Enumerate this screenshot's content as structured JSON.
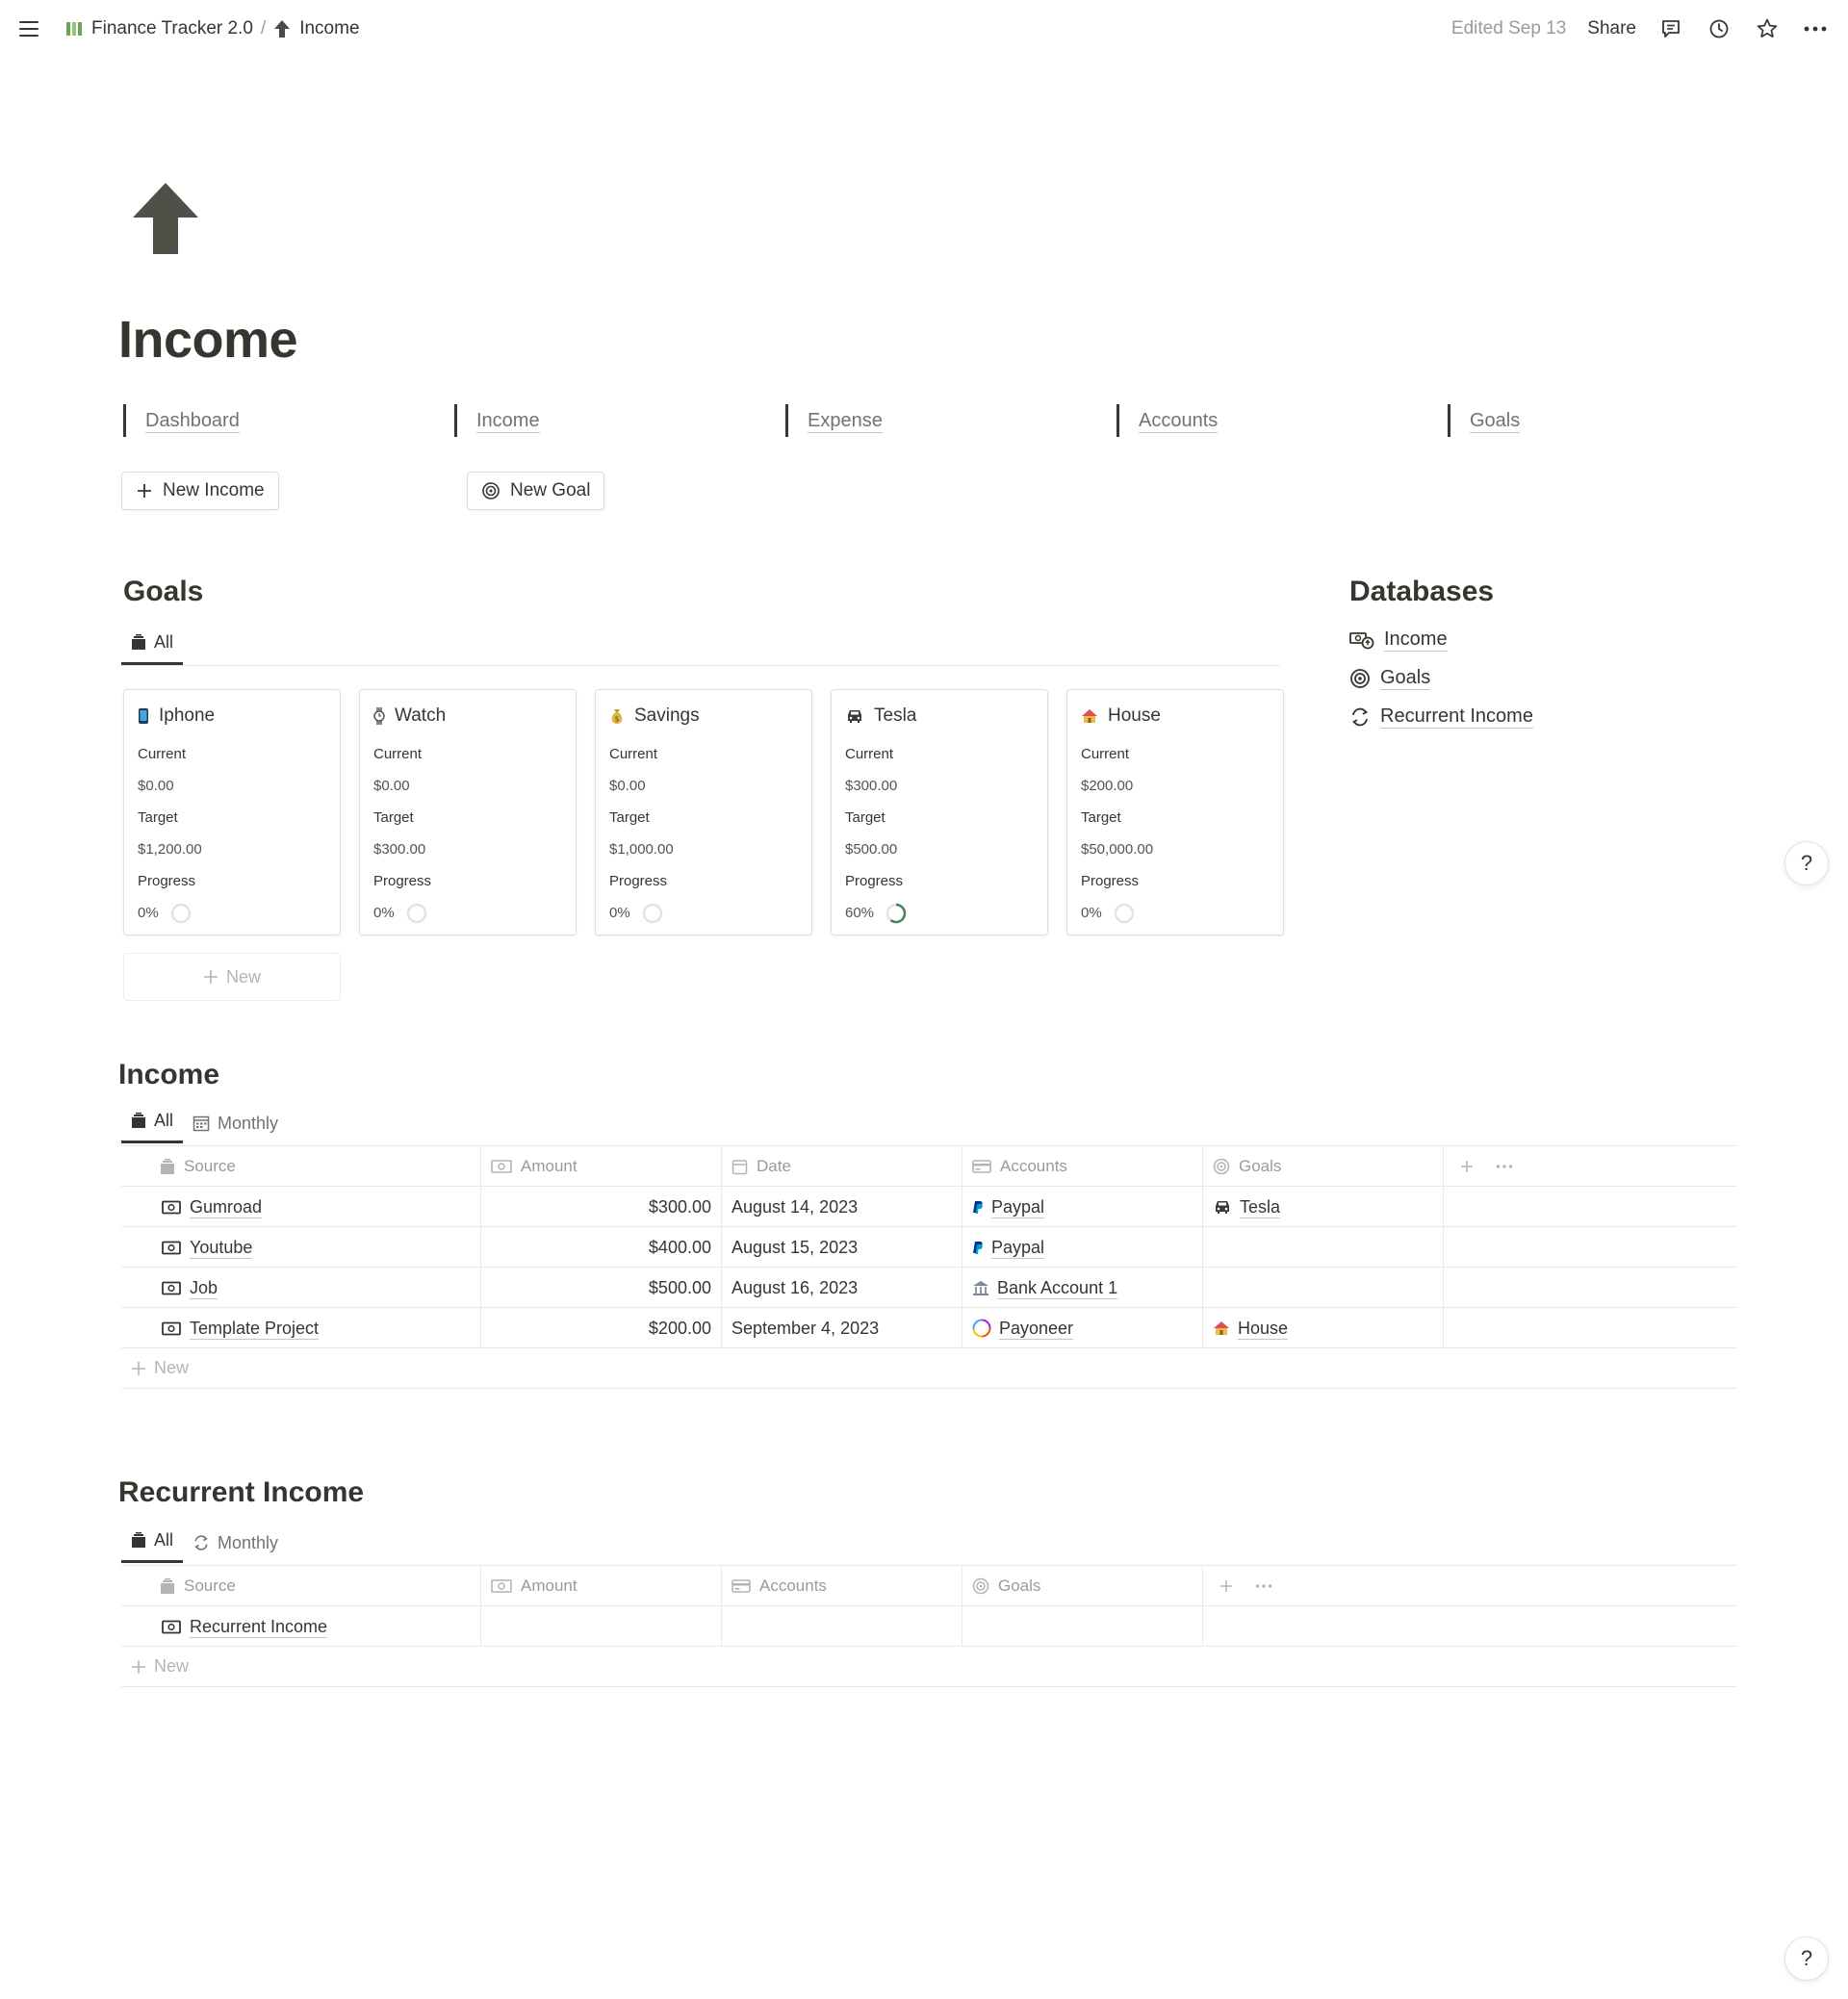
{
  "breadcrumb": {
    "workspace": "Finance Tracker 2.0",
    "separator": "/",
    "page": "Income"
  },
  "topbar": {
    "edited": "Edited Sep 13",
    "share": "Share"
  },
  "page": {
    "title": "Income"
  },
  "nav_links": [
    "Dashboard",
    "Income",
    "Expense",
    "Accounts",
    "Goals"
  ],
  "buttons": {
    "new_income": "New Income",
    "new_goal": "New Goal"
  },
  "goals": {
    "heading": "Goals",
    "tab_all": "All",
    "labels": {
      "current": "Current",
      "target": "Target",
      "progress": "Progress"
    },
    "new_label": "New",
    "cards": [
      {
        "name": "Iphone",
        "icon": "phone-icon",
        "current": "$0.00",
        "target": "$1,200.00",
        "progress": "0%",
        "progress_value": 0
      },
      {
        "name": "Watch",
        "icon": "watch-icon",
        "current": "$0.00",
        "target": "$300.00",
        "progress": "0%",
        "progress_value": 0
      },
      {
        "name": "Savings",
        "icon": "money-bag-icon",
        "current": "$0.00",
        "target": "$1,000.00",
        "progress": "0%",
        "progress_value": 0
      },
      {
        "name": "Tesla",
        "icon": "car-icon",
        "current": "$300.00",
        "target": "$500.00",
        "progress": "60%",
        "progress_value": 0.6
      },
      {
        "name": "House",
        "icon": "house-icon",
        "current": "$200.00",
        "target": "$50,000.00",
        "progress": "0%",
        "progress_value": 0
      }
    ]
  },
  "databases": {
    "heading": "Databases",
    "items": [
      "Income",
      "Goals",
      "Recurrent Income"
    ]
  },
  "income": {
    "heading": "Income",
    "tabs": [
      "All",
      "Monthly"
    ],
    "columns": [
      "Source",
      "Amount",
      "Date",
      "Accounts",
      "Goals"
    ],
    "rows": [
      {
        "source": "Gumroad",
        "amount": "$300.00",
        "date": "August 14, 2023",
        "account": "Paypal",
        "account_icon": "paypal-icon",
        "goal": "Tesla",
        "goal_icon": "car-icon"
      },
      {
        "source": "Youtube",
        "amount": "$400.00",
        "date": "August 15, 2023",
        "account": "Paypal",
        "account_icon": "paypal-icon",
        "goal": "",
        "goal_icon": ""
      },
      {
        "source": "Job",
        "amount": "$500.00",
        "date": "August 16, 2023",
        "account": "Bank Account 1",
        "account_icon": "bank-icon",
        "goal": "",
        "goal_icon": ""
      },
      {
        "source": "Template Project",
        "amount": "$200.00",
        "date": "September 4, 2023",
        "account": "Payoneer",
        "account_icon": "payoneer-icon",
        "goal": "House",
        "goal_icon": "house-icon"
      }
    ],
    "new_label": "New"
  },
  "recurrent": {
    "heading": "Recurrent Income",
    "tabs": [
      "All",
      "Monthly"
    ],
    "columns": [
      "Source",
      "Amount",
      "Accounts",
      "Goals"
    ],
    "rows": [
      {
        "source": "Recurrent Income"
      }
    ],
    "new_label": "New"
  },
  "help": "?",
  "colors": {
    "text": "#37352f",
    "muted": "#9b9a97",
    "progress": "#448361",
    "border": "#e9e9e7"
  }
}
